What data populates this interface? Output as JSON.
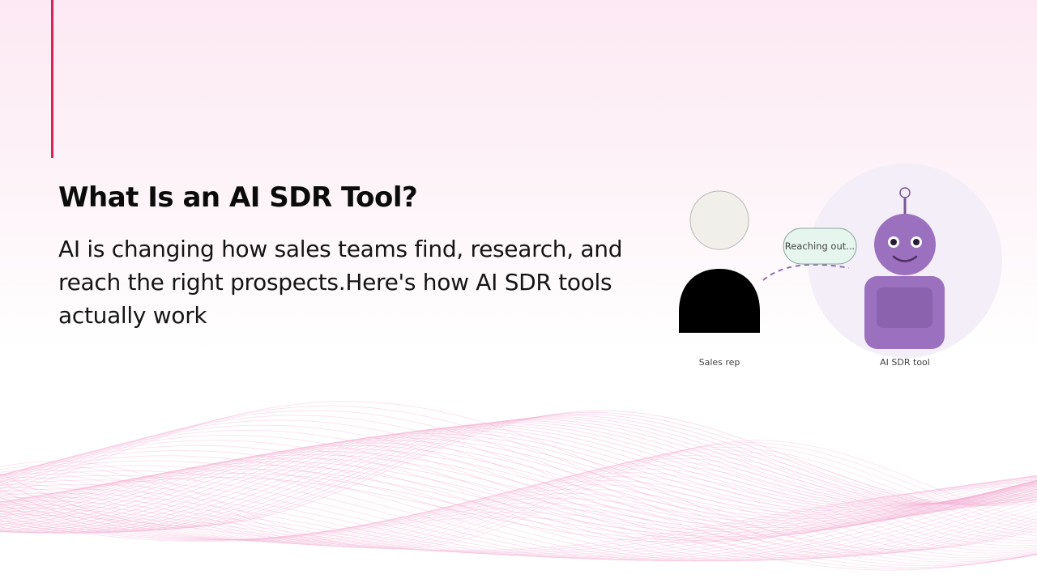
{
  "title": "What Is an AI SDR Tool?",
  "body": "AI is changing how sales teams find, research, and reach the right prospects.Here's how AI SDR tools actually work",
  "illustration": {
    "sales_rep_label": "Sales rep",
    "ai_tool_label": "AI SDR tool",
    "bubble_text": "Reaching out..."
  },
  "colors": {
    "accent": "#d6245a",
    "robot": "#9b70bf",
    "bubble": "#e6f6ef",
    "waves": "#f3b3d6"
  }
}
